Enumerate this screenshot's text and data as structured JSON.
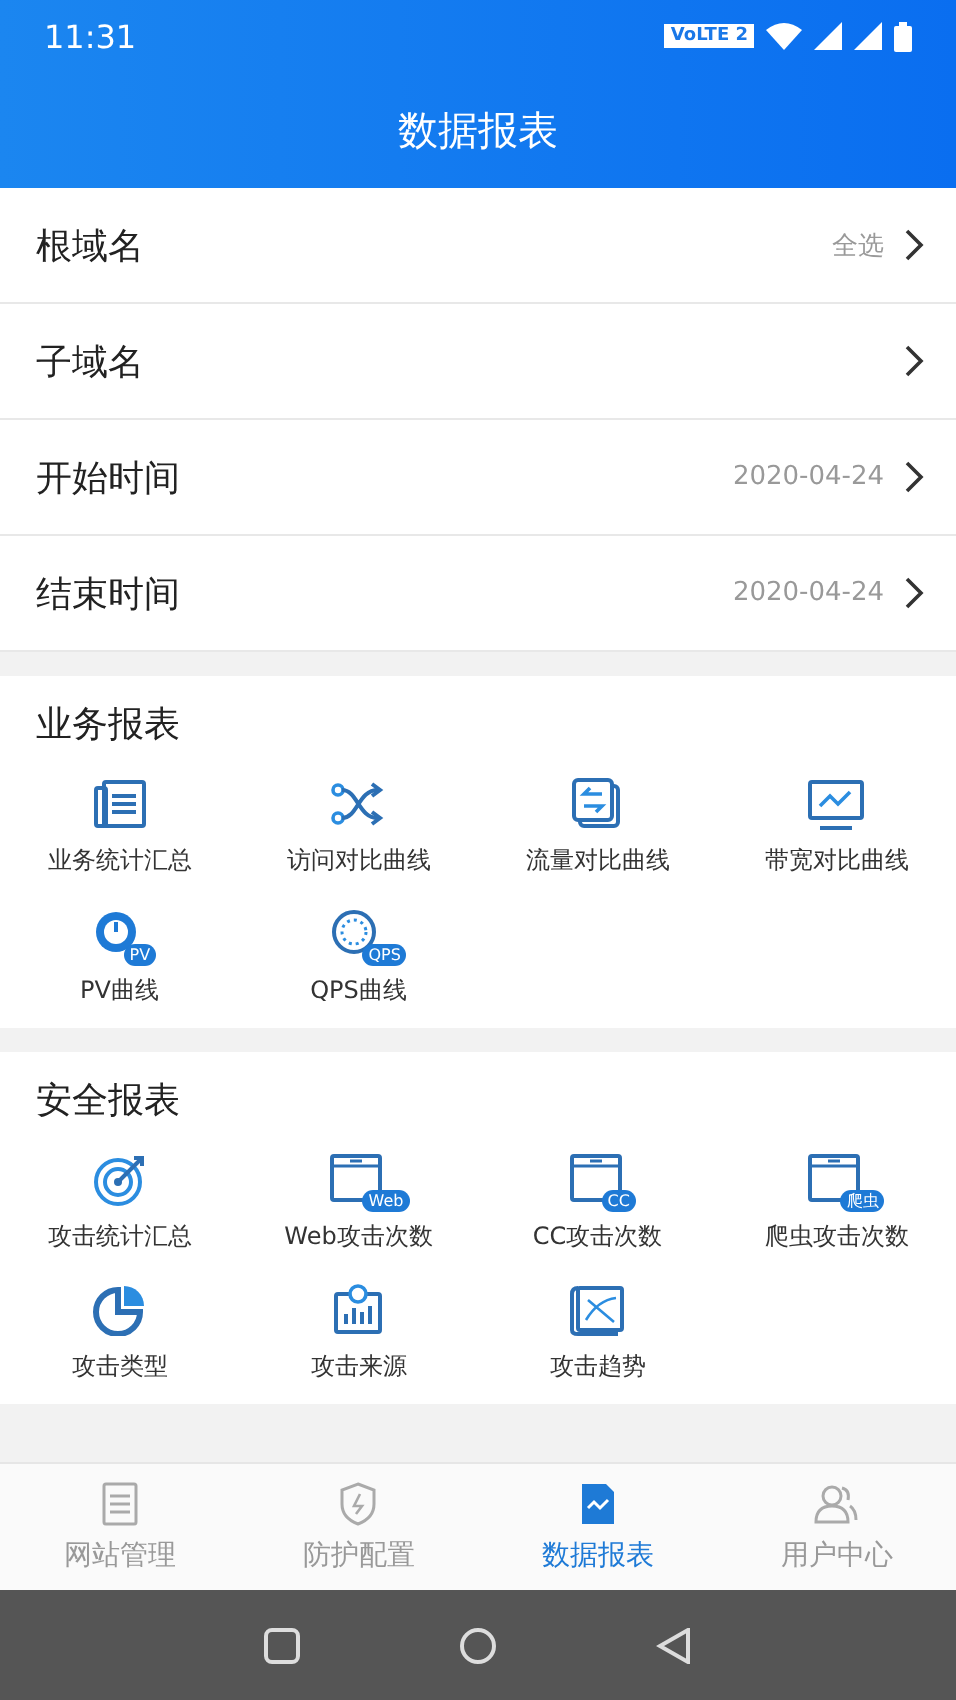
{
  "status_bar": {
    "time": "11:31",
    "network_label": "VoLTE 2"
  },
  "header": {
    "title": "数据报表"
  },
  "filters": [
    {
      "label": "根域名",
      "value": "全选"
    },
    {
      "label": "子域名"
    },
    {
      "label": "开始时间",
      "value": "2020-04-24"
    },
    {
      "label": "结束时间",
      "value": "2020-04-24"
    }
  ],
  "sections": [
    {
      "title": "业务报表",
      "items": [
        {
          "label": "业务统计汇总"
        },
        {
          "label": "访问对比曲线"
        },
        {
          "label": "流量对比曲线"
        },
        {
          "label": "带宽对比曲线"
        },
        {
          "label": "PV曲线",
          "badge": "PV"
        },
        {
          "label": "QPS曲线",
          "badge": "QPS"
        }
      ]
    },
    {
      "title": "安全报表",
      "items": [
        {
          "label": "攻击统计汇总"
        },
        {
          "label": "Web攻击次数",
          "badge": "Web"
        },
        {
          "label": "CC攻击次数",
          "badge": "CC"
        },
        {
          "label": "爬虫攻击次数",
          "badge": "爬虫"
        },
        {
          "label": "攻击类型"
        },
        {
          "label": "攻击来源"
        },
        {
          "label": "攻击趋势"
        }
      ]
    }
  ],
  "tabs": [
    {
      "label": "网站管理",
      "selected": false
    },
    {
      "label": "防护配置",
      "selected": false
    },
    {
      "label": "数据报表",
      "selected": true
    },
    {
      "label": "用户中心",
      "selected": false
    }
  ]
}
